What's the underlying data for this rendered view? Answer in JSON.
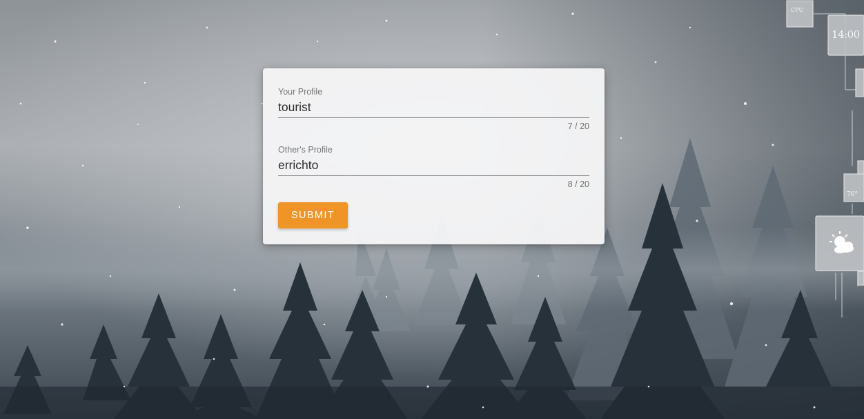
{
  "form": {
    "your_profile": {
      "label": "Your Profile",
      "value": "tourist",
      "counter": "7 / 20"
    },
    "others_profile": {
      "label": "Other's Profile",
      "value": "errichto",
      "counter": "8 / 20"
    },
    "submit_label": "SUBMIT"
  },
  "desktop_widgets": {
    "cpu_label": "CPU",
    "clock": "14:00",
    "temperature": "76°",
    "weather_icon": "partly-cloudy-icon"
  },
  "colors": {
    "accent": "#ef9426",
    "card_background": "#f5f5f6"
  }
}
